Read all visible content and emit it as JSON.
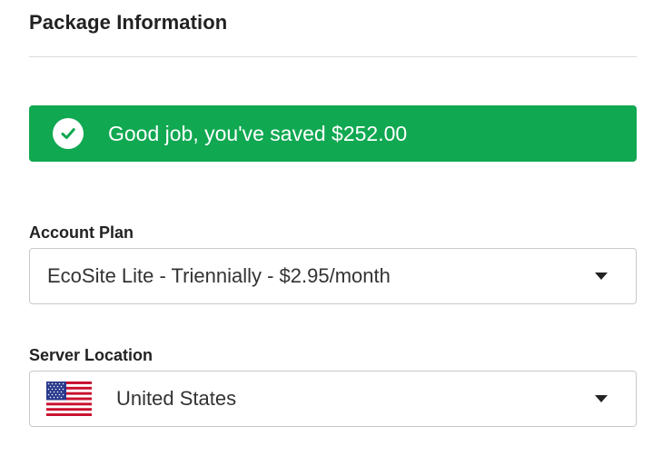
{
  "section": {
    "title": "Package Information"
  },
  "banner": {
    "message": "Good job, you've saved $252.00",
    "color": "#10a851",
    "icon": "check-circle-icon"
  },
  "account_plan": {
    "label": "Account Plan",
    "selected": "EcoSite Lite - Triennially - $2.95/month"
  },
  "server_location": {
    "label": "Server Location",
    "selected": "United States",
    "flag_icon": "us-flag-icon"
  }
}
